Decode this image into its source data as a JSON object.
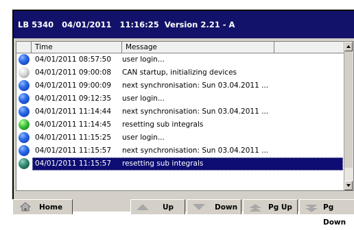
{
  "titlebar": {
    "text": "LB 5340   04/01/2011   11:16:25  Version 2.21 - A"
  },
  "table": {
    "columns": [
      "",
      "Time",
      "Message",
      ""
    ],
    "rows": [
      {
        "icon": "blue",
        "time": "04/01/2011 08:57:50",
        "message": "user login..."
      },
      {
        "icon": "gray",
        "time": "04/01/2011 09:00:08",
        "message": "CAN startup, initializing devices"
      },
      {
        "icon": "blue",
        "time": "04/01/2011 09:00:09",
        "message": "next synchronisation: Sun 03.04.2011 ..."
      },
      {
        "icon": "blue",
        "time": "04/01/2011 09:12:35",
        "message": "user login..."
      },
      {
        "icon": "blue",
        "time": "04/01/2011 11:14:44",
        "message": "next synchronisation: Sun 03.04.2011 ..."
      },
      {
        "icon": "green",
        "time": "04/01/2011 11:14:45",
        "message": "resetting sub integrals"
      },
      {
        "icon": "blue",
        "time": "04/01/2011 11:15:25",
        "message": "user login..."
      },
      {
        "icon": "blue",
        "time": "04/01/2011 11:15:57",
        "message": "next synchronisation: Sun 03.04.2011 ..."
      },
      {
        "icon": "teal",
        "time": "04/01/2011 11:15:57",
        "message": "resetting sub integrals",
        "selected": true
      }
    ]
  },
  "buttons": {
    "home": "Home",
    "up": "Up",
    "down": "Down",
    "pg_up": "Pg Up",
    "pg_down": "Pg Down"
  },
  "icons": {
    "home": "house-icon",
    "up": "arrow-up-icon",
    "down": "arrow-down-icon",
    "pg_up": "page-up-icon",
    "pg_down": "page-down-icon"
  },
  "colors": {
    "titlebar": "#12126a",
    "selection": "#0d0d73"
  }
}
